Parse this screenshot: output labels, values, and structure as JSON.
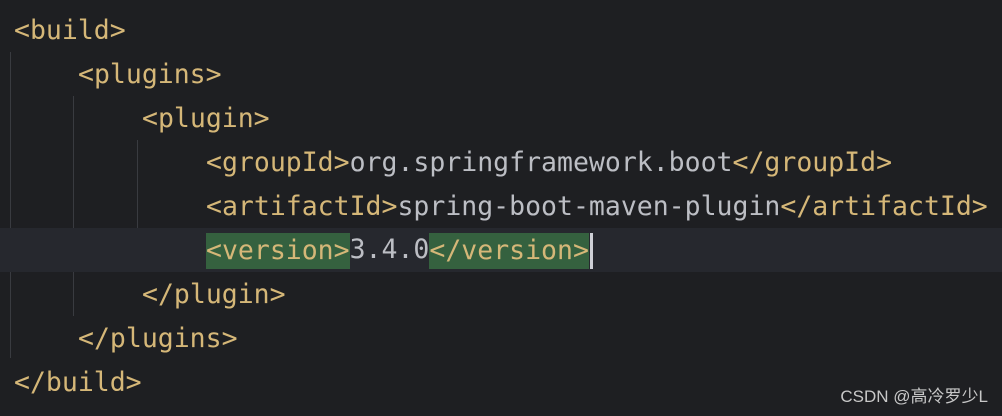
{
  "editor": {
    "lines": [
      {
        "open": "<build>"
      },
      {
        "open": "<plugins>"
      },
      {
        "open": "<plugin>"
      },
      {
        "open": "<groupId>",
        "text": "org.springframework.boot",
        "close": "</groupId>"
      },
      {
        "open": "<artifactId>",
        "text": "spring-boot-maven-plugin",
        "close": "</artifactId>"
      },
      {
        "open": "<version>",
        "text": "3.4.0",
        "close": "</version>"
      },
      {
        "open": "</plugin>"
      },
      {
        "open": "</plugins>"
      },
      {
        "open": "</build>"
      }
    ]
  },
  "watermark": "CSDN @高冷罗少L",
  "colors": {
    "background": "#1e1f22",
    "current_line": "#26282e",
    "tag": "#d5b778",
    "text": "#bcbec4",
    "tag_match_highlight": "#35613f"
  }
}
